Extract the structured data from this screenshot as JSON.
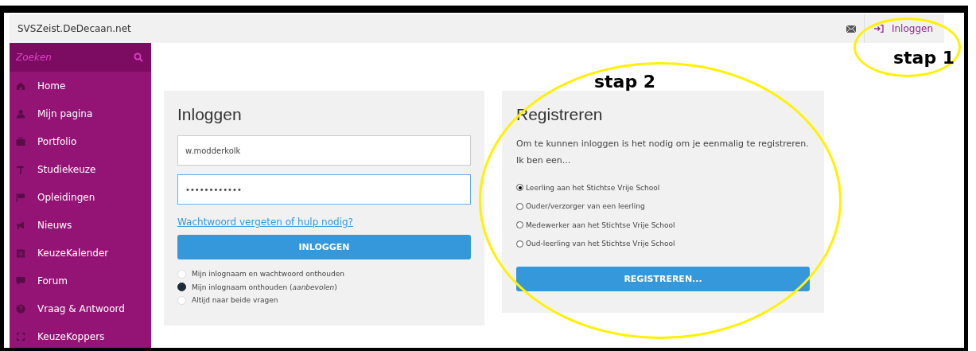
{
  "header": {
    "site_title": "SVSZeist.DeDecaan.net",
    "login_link": "Inloggen"
  },
  "sidebar": {
    "search": {
      "placeholder": "Zoeken"
    },
    "items": [
      {
        "label": "Home",
        "kind": "home"
      },
      {
        "label": "Mijn pagina",
        "kind": "user"
      },
      {
        "label": "Portfolio",
        "kind": "briefcase"
      },
      {
        "label": "Studiekeuze",
        "kind": "signpost"
      },
      {
        "label": "Opleidingen",
        "kind": "flag"
      },
      {
        "label": "Nieuws",
        "kind": "megaphone"
      },
      {
        "label": "KeuzeKalender",
        "kind": "calendar"
      },
      {
        "label": "Forum",
        "kind": "chat"
      },
      {
        "label": "Vraag & Antwoord",
        "kind": "question"
      },
      {
        "label": "KeuzeKoppers",
        "kind": "arrows"
      }
    ]
  },
  "login": {
    "title": "Inloggen",
    "username": "w.modderkolk",
    "password": "••••••••••••",
    "forgot_link": "Wachtwoord vergeten of hulp nodig?",
    "button": "INLOGGEN",
    "options": [
      {
        "label": "Mijn inlognaam en wachtwoord onthouden",
        "selected": false
      },
      {
        "label": "Mijn inlognaam onthouden (*aanbevolen*)",
        "selected": true
      },
      {
        "label": "Altijd naar beide vragen",
        "selected": false
      }
    ]
  },
  "register": {
    "title": "Registreren",
    "intro": [
      "Om te kunnen inloggen is het nodig om je eenmalig te registreren.",
      "Ik ben een..."
    ],
    "options": [
      {
        "label": "Leerling aan het Stichtse Vrije School",
        "selected": true
      },
      {
        "label": "Ouder/verzorger van een leerling",
        "selected": false
      },
      {
        "label": "Medewerker aan het Stichtse Vrije School",
        "selected": false
      },
      {
        "label": "Oud-leerling van het Stichtse Vrije School",
        "selected": false
      }
    ],
    "button": "REGISTREREN..."
  },
  "annotations": [
    {
      "text": "stap 1"
    },
    {
      "text": "stap 2"
    }
  ]
}
